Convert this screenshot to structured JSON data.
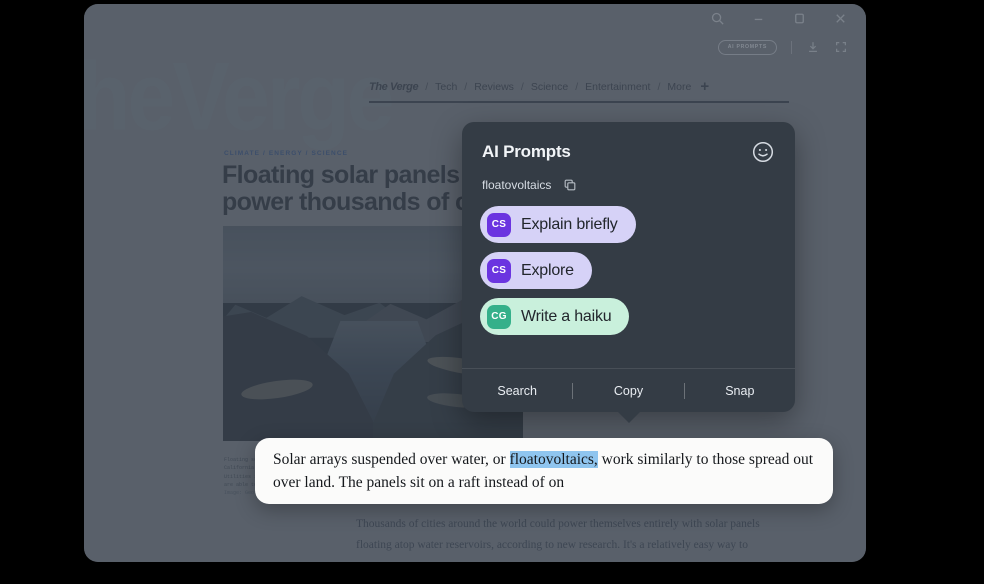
{
  "window": {
    "titlebar_icons": [
      "search-icon",
      "minimize-icon",
      "maximize-icon",
      "close-icon"
    ],
    "toolbar": {
      "ai_pill_label": "AI PROMPTS",
      "icons": [
        "download-icon",
        "expand-icon"
      ]
    }
  },
  "site": {
    "watermark": "heVerge",
    "nav": {
      "logo": "The Verge",
      "items": [
        "Tech",
        "Reviews",
        "Science",
        "Entertainment",
        "More"
      ],
      "separator": "/",
      "plus": "+"
    }
  },
  "article": {
    "kicker": "CLIMATE / ENERGY / SCIENCE",
    "headline": "Floating solar panels could power thousands of cities",
    "caption": "Floating solar panels on a reservoir in California on Tuesday, Feb. 8, 2022. Utilities in areas with a reservoirs are able to ge",
    "caption_credit": "Image: Georgiana Cha / Bloomberg",
    "body": "Thousands of cities around the world could power themselves entirely with solar panels floating atop water reservoirs, according to new research. It's a relatively easy way to generate renewable energy locally"
  },
  "popup": {
    "title": "AI Prompts",
    "smiley_icon": "smiley-icon",
    "term": "floatovoltaics",
    "copy_icon": "copy-icon",
    "prompts": [
      {
        "badge": "CS",
        "label": "Explain briefly",
        "theme": "lav",
        "badge_theme": "cs"
      },
      {
        "badge": "CS",
        "label": "Explore",
        "theme": "lav",
        "badge_theme": "cs"
      },
      {
        "badge": "CG",
        "label": "Write a haiku",
        "theme": "mint",
        "badge_theme": "cg"
      }
    ],
    "footer": [
      "Search",
      "Copy",
      "Snap"
    ]
  },
  "selection_card": {
    "text_before": "Solar arrays suspended over water, or ",
    "highlight": "floatovoltaics,",
    "text_after": " work similarly to those spread out over land. The panels sit on a raft instead of on"
  },
  "colors": {
    "page_bg": "#6a717a",
    "popup_bg": "#343c45",
    "chip_lavender": "#d6d2f7",
    "chip_mint": "#c9f0dc",
    "badge_purple": "#6b34e0",
    "badge_teal": "#35b08a",
    "selection_highlight": "#8fc5ef",
    "card_bg": "#fbfbfa"
  }
}
